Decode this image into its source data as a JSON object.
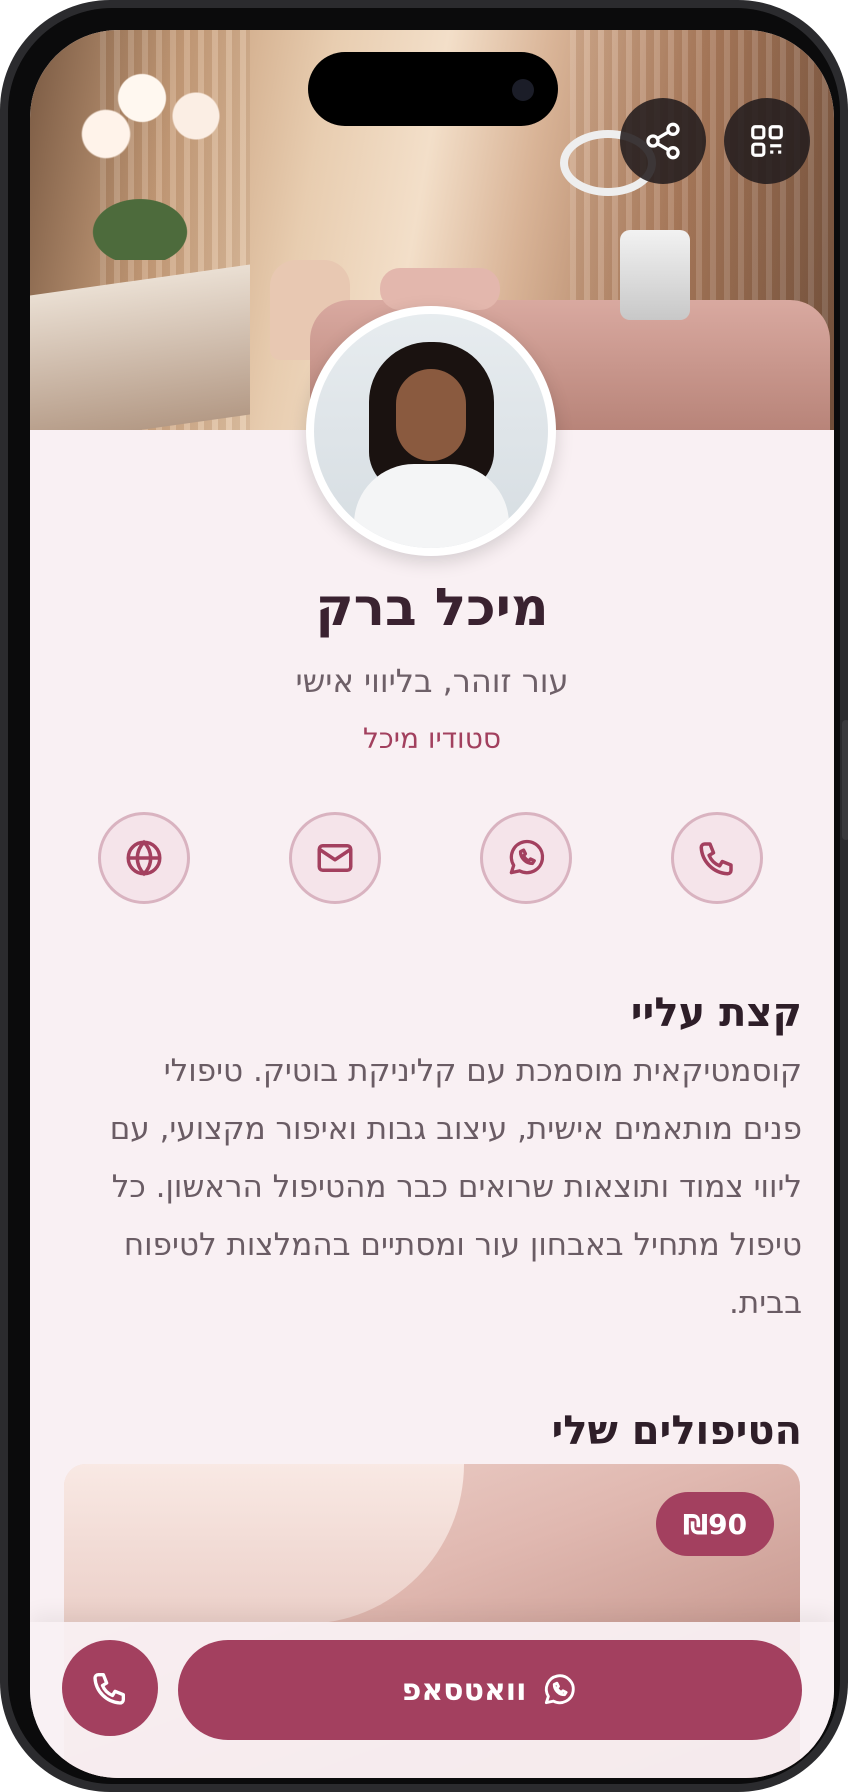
{
  "header": {
    "share_icon": "share-icon",
    "qr_icon": "qr-code-icon"
  },
  "profile": {
    "name": "מיכל ברק",
    "title": "עור זוהר, בליווי אישי",
    "company": "סטודיו מיכל"
  },
  "actions": [
    {
      "name": "globe-icon"
    },
    {
      "name": "mail-icon"
    },
    {
      "name": "whatsapp-icon"
    },
    {
      "name": "phone-icon"
    }
  ],
  "about": {
    "heading": "קצת עליי",
    "text": "קוסמטיקאית מוסמכת עם קליניקת בוטיק. טיפולי פנים מותאמים אישית, עיצוב גבות ואיפור מקצועי, עם ליווי צמוד ותוצאות שרואים כבר מהטיפול הראשון. כל טיפול מתחיל באבחון עור ומסתיים בהמלצות לטיפוח בבית."
  },
  "treatments": {
    "heading": "הטיפולים שלי",
    "items": [
      {
        "price": "₪90"
      }
    ]
  },
  "bottom_bar": {
    "whatsapp_label": "וואטסאפ"
  },
  "colors": {
    "accent": "#a3405f",
    "background": "#f9f0f3",
    "text": "#2e1e28"
  }
}
